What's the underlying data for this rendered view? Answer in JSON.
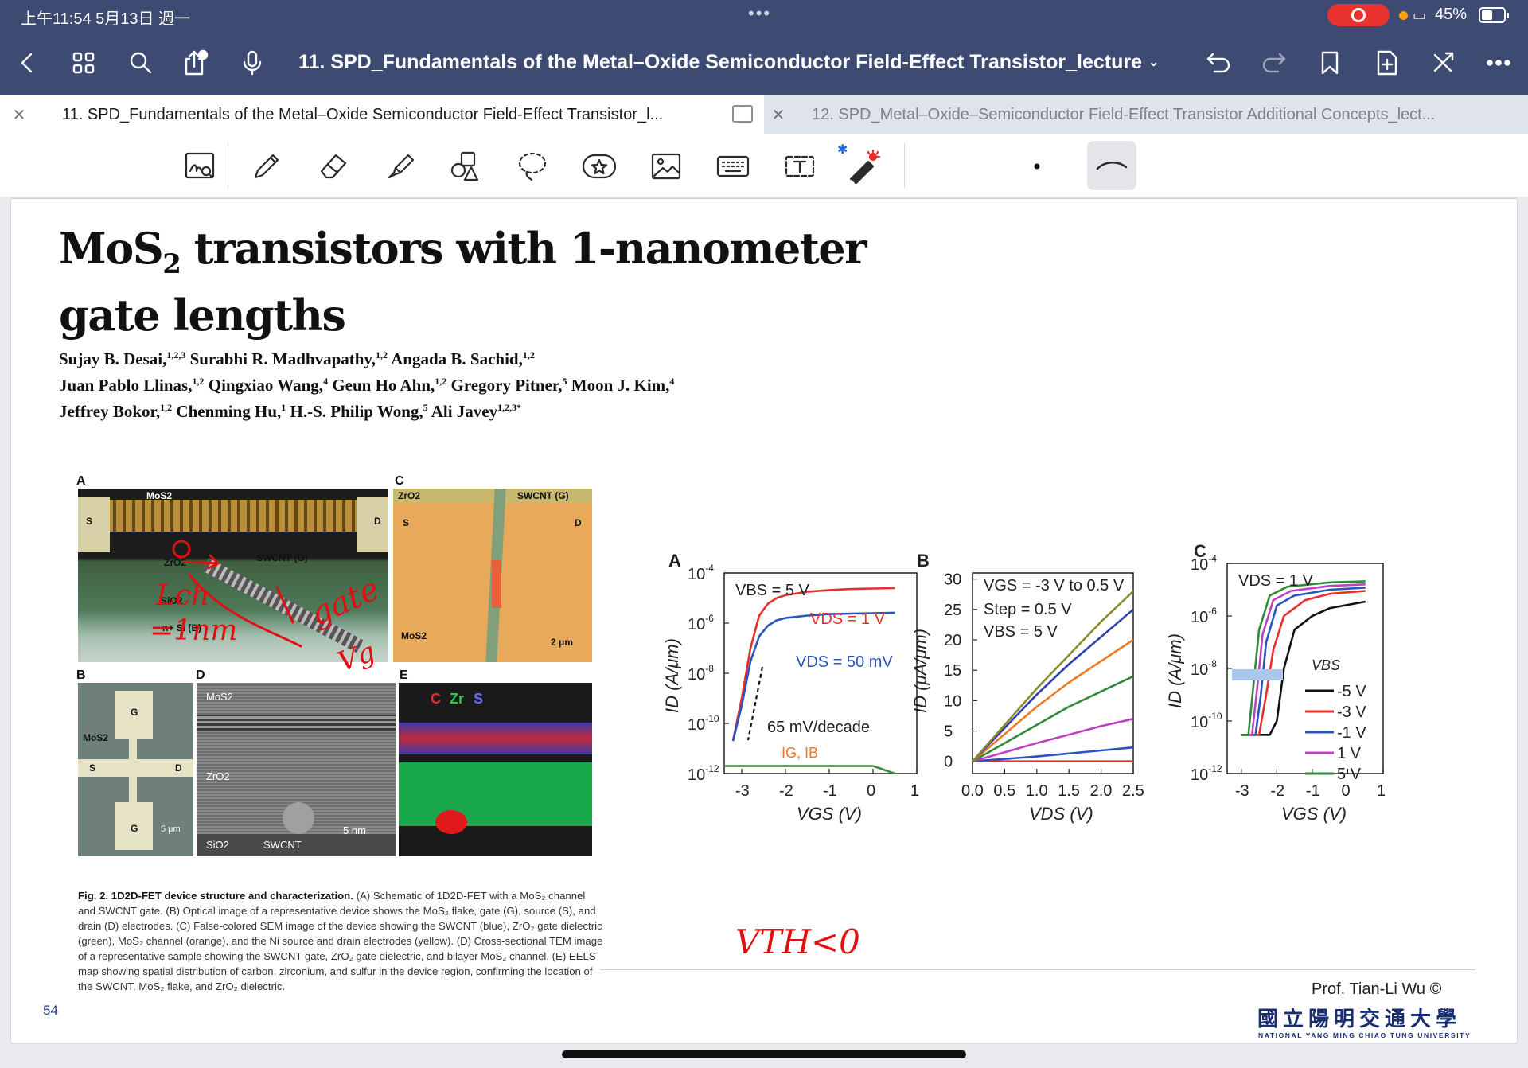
{
  "status_bar": {
    "time_date": "上午11:54   5月13日 週一",
    "more": "•••",
    "battery": "45%"
  },
  "nav": {
    "doc_title": "11. SPD_Fundamentals of the Metal–Oxide Semiconductor Field-Effect Transistor_lecture",
    "title_chevron": "⌄",
    "icons": [
      "back-icon",
      "grid-icon",
      "search-icon",
      "share-icon",
      "microphone-icon",
      "undo-icon",
      "redo-icon",
      "bookmark-icon",
      "add-page-icon",
      "close-tools-icon",
      "more-icon"
    ]
  },
  "tabs": [
    {
      "label": "11. SPD_Fundamentals of the Metal–Oxide Semiconductor Field-Effect Transistor_l...",
      "active": true
    },
    {
      "label": "12. SPD_Metal–Oxide–Semiconductor Field-Effect Transistor Additional Concepts_lect...",
      "active": false
    }
  ],
  "toolbar": {
    "tools": [
      "zoom-write-icon",
      "pen-icon",
      "eraser-icon",
      "highlighter-icon",
      "shapes-icon",
      "lasso-icon",
      "sticker-icon",
      "image-icon",
      "keyboard-icon",
      "text-icon",
      "laser-pointer-icon"
    ],
    "bluetooth": "✱"
  },
  "slide": {
    "title_line1": "MoS",
    "title_sub": "2",
    "title_line1_rest": " transistors with 1-nanometer",
    "title_line2": "gate lengths",
    "authors": [
      "Sujay B. Desai,",
      "1,2,3",
      " Surabhi R. Madhvapathy,",
      "1,2",
      " Angada B. Sachid,",
      "1,2",
      "Juan Pablo Llinas,",
      "1,2",
      " Qingxiao Wang,",
      "4",
      " Geun Ho Ahn,",
      "1,2",
      " Gregory Pitner,",
      "5",
      " Moon J. Kim,",
      "4",
      "Jeffrey Bokor,",
      "1,2",
      " Chenming Hu,",
      "1",
      " H.-S. Philip Wong,",
      "5",
      " Ali Javey",
      "1,2,3*"
    ],
    "fig_left": {
      "panel_labels": [
        "A",
        "B",
        "C",
        "D",
        "E"
      ],
      "a_labels": [
        "MoS2",
        "S",
        "D",
        "ZrO2",
        "SWCNT (G)",
        "SiO2",
        "n+ Si (B)"
      ],
      "c_labels": [
        "ZrO2",
        "SWCNT (G)",
        "S",
        "D",
        "MoS2",
        "2 μm"
      ],
      "b_labels": [
        "G",
        "MoS2",
        "S",
        "D",
        "G",
        "5 μm"
      ],
      "d_labels": [
        "MoS2",
        "ZrO2",
        "SiO2",
        "SWCNT",
        "5 nm"
      ],
      "e_labels": [
        "C",
        "Zr",
        "S"
      ]
    },
    "caption": {
      "lead": "Fig. 2. 1D2D-FET device structure and characterization.",
      "body": " (A) Schematic of 1D2D-FET with a MoS₂ channel and SWCNT gate. (B) Optical image of a representative device shows the MoS₂ flake, gate (G), source (S), and drain (D) electrodes. (C) False-colored SEM image of the device showing the SWCNT (blue), ZrO₂ gate dielectric (green), MoS₂ channel (orange), and the Ni source and drain electrodes (yellow). (D) Cross-sectional TEM image of a representative sample showing the SWCNT gate, ZrO₂ gate dielectric, and bilayer MoS₂ channel. (E) EELS map showing spatial distribution of carbon, zirconium, and sulfur in the device region, confirming the location of the SWCNT, MoS₂ flake, and ZrO₂ dielectric."
    },
    "page_number": "54",
    "credit": "Prof. Tian-Li Wu ©",
    "univ_zh": "國立陽明交通大學",
    "univ_en": "NATIONAL YANG MING CHIAO TUNG UNIVERSITY",
    "annotations": {
      "lch": "Lch",
      "eq": "=1nm",
      "gate": "gate",
      "vg": "Vg",
      "vth": "VTH<0"
    }
  },
  "chart_data": [
    {
      "type": "line",
      "panel": "A",
      "xlabel": "VGS (V)",
      "ylabel": "ID (A/μm)",
      "yscale": "log",
      "xlim": [
        -3.4,
        1
      ],
      "ylim": [
        1e-12,
        0.0001
      ],
      "x_ticks": [
        "-3",
        "-2",
        "-1",
        "0",
        "1"
      ],
      "y_ticks": [
        "10-4",
        "10-6",
        "10-8",
        "10-10",
        "10-12"
      ],
      "annotations": [
        "VBS = 5 V",
        "VDS = 1 V",
        "VDS = 50 mV",
        "65 mV/decade",
        "IG, IB"
      ],
      "series": [
        {
          "name": "VDS = 1 V",
          "color": "#e8302a",
          "x": [
            -3.2,
            -3.0,
            -2.8,
            -2.6,
            -2.4,
            -2.2,
            -2.0,
            -1.5,
            -1.0,
            -0.5,
            0.0,
            0.5
          ],
          "y": [
            2e-11,
            1e-09,
            1e-07,
            2e-06,
            6e-06,
            1e-05,
            1.3e-05,
            1.8e-05,
            2.1e-05,
            2.3e-05,
            2.4e-05,
            2.5e-05
          ]
        },
        {
          "name": "VDS = 50 mV",
          "color": "#2a55c0",
          "x": [
            -3.2,
            -3.0,
            -2.8,
            -2.6,
            -2.4,
            -2.2,
            -2.0,
            -1.5,
            -1.0,
            -0.5,
            0.0,
            0.5
          ],
          "y": [
            2e-11,
            5e-10,
            3e-08,
            3e-07,
            8e-07,
            1.3e-06,
            1.6e-06,
            2e-06,
            2.3e-06,
            2.4e-06,
            2.5e-06,
            2.6e-06
          ]
        },
        {
          "name": "IG, IB",
          "color": "#3a8a3a",
          "x": [
            -3.4,
            -3.0,
            -2.0,
            -1.0,
            0.0,
            0.5
          ],
          "y": [
            2e-12,
            2e-12,
            2e-12,
            2e-12,
            2e-12,
            1e-12
          ]
        }
      ]
    },
    {
      "type": "line",
      "panel": "B",
      "xlabel": "VDS (V)",
      "ylabel": "ID (μA/μm)",
      "xlim": [
        0,
        2.5
      ],
      "ylim": [
        -2,
        31
      ],
      "x_ticks": [
        "0.0",
        "0.5",
        "1.0",
        "1.5",
        "2.0",
        "2.5"
      ],
      "y_ticks": [
        "0",
        "5",
        "10",
        "15",
        "20",
        "25",
        "30"
      ],
      "annotations": [
        "VGS = -3 V to 0.5 V",
        "Step = 0.5 V",
        "VBS = 5 V"
      ],
      "series": [
        {
          "color": "#e8302a",
          "x": [
            0,
            2.5
          ],
          "y": [
            0,
            0
          ]
        },
        {
          "color": "#2a55c0",
          "x": [
            0,
            0.5,
            1.0,
            1.5,
            2.0,
            2.5
          ],
          "y": [
            0,
            0.4,
            0.8,
            1.3,
            1.8,
            2.3
          ]
        },
        {
          "color": "#c040c0",
          "x": [
            0,
            0.5,
            1.0,
            1.5,
            2.0,
            2.5
          ],
          "y": [
            0,
            1.5,
            3,
            4.4,
            5.8,
            7
          ]
        },
        {
          "color": "#2f8a3a",
          "x": [
            0,
            0.5,
            1.0,
            1.5,
            2.0,
            2.5
          ],
          "y": [
            0,
            3,
            6,
            9,
            11.5,
            14
          ]
        },
        {
          "color": "#f07820",
          "x": [
            0,
            0.5,
            1.0,
            1.5,
            2.0,
            2.5
          ],
          "y": [
            0,
            4.5,
            9,
            13,
            16.5,
            20
          ]
        },
        {
          "color": "#3040b0",
          "x": [
            0,
            0.5,
            1.0,
            1.5,
            2.0,
            2.5
          ],
          "y": [
            0,
            5.5,
            11,
            16,
            20.5,
            25
          ]
        },
        {
          "color": "#8a8a30",
          "x": [
            0,
            0.5,
            1.0,
            1.5,
            2.0,
            2.5
          ],
          "y": [
            0,
            6,
            12,
            17.5,
            23,
            28
          ]
        }
      ]
    },
    {
      "type": "line",
      "panel": "C",
      "xlabel": "VGS (V)",
      "ylabel": "ID (A/μm)",
      "yscale": "log",
      "xlim": [
        -3.4,
        1
      ],
      "ylim": [
        1e-12,
        0.0001
      ],
      "x_ticks": [
        "-3",
        "-2",
        "-1",
        "0",
        "1"
      ],
      "y_ticks": [
        "10-4",
        "10-6",
        "10-8",
        "10-10",
        "10-12"
      ],
      "annotations": [
        "VDS = 1 V",
        "VBS"
      ],
      "series": [
        {
          "name": "-5 V",
          "color": "#111111",
          "x": [
            -3.0,
            -2.2,
            -2.0,
            -1.8,
            -1.5,
            -1.0,
            -0.5,
            0.5
          ],
          "y": [
            3e-11,
            3e-11,
            1e-10,
            1e-08,
            3e-07,
            1e-06,
            2e-06,
            3.5e-06
          ]
        },
        {
          "name": "-3 V",
          "color": "#e8302a",
          "x": [
            -3.0,
            -2.5,
            -2.3,
            -2.1,
            -1.8,
            -1.2,
            -0.5,
            0.5
          ],
          "y": [
            3e-11,
            3e-11,
            1e-09,
            5e-08,
            1e-06,
            4e-06,
            7e-06,
            9e-06
          ]
        },
        {
          "name": "-1 V",
          "color": "#2a55c0",
          "x": [
            -3.0,
            -2.6,
            -2.45,
            -2.3,
            -2.0,
            -1.5,
            -0.5,
            0.5
          ],
          "y": [
            3e-11,
            3e-11,
            1e-09,
            1e-07,
            2.5e-06,
            6e-06,
            1e-05,
            1.2e-05
          ]
        },
        {
          "name": "1 V",
          "color": "#c040c0",
          "x": [
            -3.0,
            -2.7,
            -2.55,
            -2.4,
            -2.1,
            -1.6,
            -0.5,
            0.5
          ],
          "y": [
            3e-11,
            3e-11,
            2e-09,
            2e-07,
            4e-06,
            9e-06,
            1.4e-05,
            1.6e-05
          ]
        },
        {
          "name": "5 V",
          "color": "#2f8a3a",
          "x": [
            -3.0,
            -2.8,
            -2.65,
            -2.5,
            -2.2,
            -1.7,
            -0.5,
            0.5
          ],
          "y": [
            3e-11,
            3e-11,
            3e-09,
            3e-07,
            6e-06,
            1.3e-05,
            1.9e-05,
            2.1e-05
          ]
        }
      ]
    }
  ]
}
